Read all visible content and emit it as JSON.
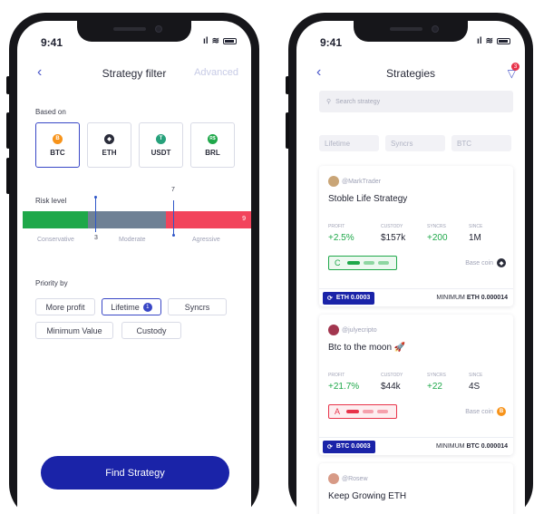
{
  "status": {
    "time": "9:41"
  },
  "filter_screen": {
    "title": "Strategy filter",
    "back_label": "‹",
    "advanced_label": "Advanced",
    "based_on_label": "Based on",
    "coins": [
      {
        "label": "BTC",
        "symbol": "B",
        "color": "#f7931a",
        "active": true
      },
      {
        "label": "ETH",
        "symbol": "◆",
        "color": "#2a2c3a",
        "active": false
      },
      {
        "label": "USDT",
        "symbol": "T",
        "color": "#26a17b",
        "active": false
      },
      {
        "label": "BRL",
        "symbol": "R$",
        "color": "#1fa84a",
        "active": false
      }
    ],
    "risk_label": "Risk level",
    "risk_numbers": {
      "low": "3",
      "mid": "7",
      "high": "9"
    },
    "risk_levels": [
      "Conservative",
      "Moderate",
      "Agressive"
    ],
    "priority_label": "Priority by",
    "priority_row1": [
      "More profit",
      "Lifetime",
      "Syncrs"
    ],
    "lifetime_badge": "1",
    "priority_row2": [
      "Minimum Value",
      "Custody"
    ],
    "find_button": "Find Strategy"
  },
  "strategies_screen": {
    "title": "Strategies",
    "filter_badge": "3",
    "search_placeholder": "Search strategy",
    "filter_chips": [
      "Lifetime",
      "Syncrs",
      "BTC"
    ],
    "stat_keys": [
      "PROFIT",
      "CUSTODY",
      "SYNCRS",
      "SINCE"
    ],
    "cards": [
      {
        "author": "@MarkTrader",
        "title": "Stoble Life Strategy",
        "profit": "+2.5%",
        "custody": "$157k",
        "syncrs": "+200",
        "since": "1M",
        "level": "C",
        "level_color": "#1fa84a",
        "base_coin_label": "Base coin",
        "base_coin": "ETH",
        "token": "ETH 0.0003",
        "minimum_label": "MINIMUM",
        "minimum_value": "ETH 0.000014"
      },
      {
        "author": "@julyecripto",
        "title": "Btc to the moon 🚀",
        "profit": "+21.7%",
        "custody": "$44k",
        "syncrs": "+22",
        "since": "4S",
        "level": "A",
        "level_color": "#e8334a",
        "base_coin_label": "Base coin",
        "base_coin": "BTC",
        "token": "BTC 0.0003",
        "minimum_label": "MINIMUM",
        "minimum_value": "BTC 0.000014"
      },
      {
        "author": "@Rosew",
        "title": "Keep Growing ETH"
      }
    ]
  }
}
